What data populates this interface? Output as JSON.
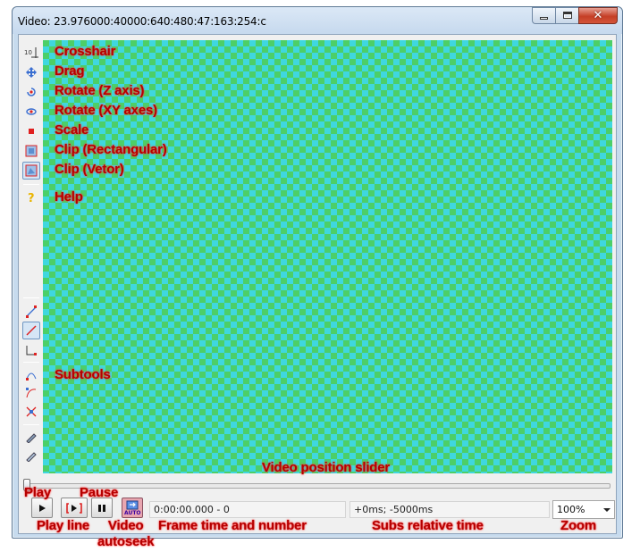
{
  "window": {
    "title": "Video: 23.976000:40000:640:480:47:163:254:c",
    "close_glyph": "✕"
  },
  "toolbar": {
    "tools": [
      {
        "name": "crosshair-icon",
        "glyph": "10",
        "label": "Crosshair"
      },
      {
        "name": "drag-icon",
        "glyph": "✥",
        "label": "Drag"
      },
      {
        "name": "rotate-z-icon",
        "glyph": "↻",
        "label": "Rotate (Z axis)"
      },
      {
        "name": "rotate-xy-icon",
        "glyph": "⟲",
        "label": "Rotate (XY axes)"
      },
      {
        "name": "scale-icon",
        "glyph": "■",
        "label": "Scale"
      },
      {
        "name": "clip-rect-icon",
        "glyph": "▣",
        "label": "Clip (Rectangular)"
      },
      {
        "name": "clip-vector-icon",
        "glyph": "◪",
        "label": "Clip (Vetor)"
      },
      {
        "name": "help-icon",
        "glyph": "?",
        "label": "Help"
      }
    ],
    "subtools_label": "Subtools"
  },
  "annotations": {
    "slider": "Video position slider",
    "play": "Play",
    "pause": "Pause",
    "play_line": "Play line",
    "video_autoseek": "Video\nautoseek",
    "frame_time": "Frame time and number",
    "subs_time": "Subs relative time",
    "zoom": "Zoom"
  },
  "controls": {
    "frame_time_value": "0:00:00.000 - 0",
    "subs_time_value": "+0ms; -5000ms",
    "zoom_value": "100%",
    "autoseek_badge": "AUTO"
  },
  "colors": {
    "checker_a": "#3fd7df",
    "checker_b": "#4ccf68",
    "annotation": "#b40000"
  }
}
